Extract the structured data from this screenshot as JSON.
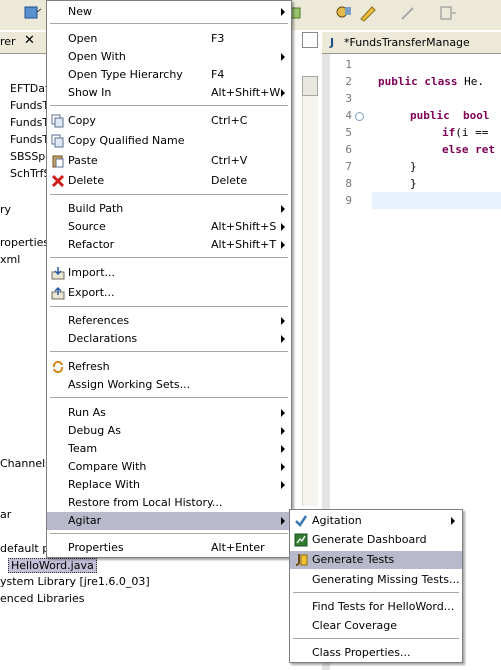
{
  "left_panel": {
    "tab_label": "rer",
    "tree_items": [
      "EFTDat",
      "FundsT",
      "FundsT",
      "FundsT",
      "SBSSpe",
      "SchTrfS",
      "ry",
      "roperties",
      "xml",
      "Channels",
      "ar",
      "default pa",
      "ystem Library [jre1.6.0_03]",
      "enced Libraries"
    ],
    "selected_file": "HelloWord.java"
  },
  "editor": {
    "tab_title": "*FundsTransferManage",
    "line_numbers": [
      "1",
      "2",
      "3",
      "4",
      "5",
      "6",
      "7",
      "8",
      "9"
    ],
    "line2_kw": "public class",
    "line2_rest": " He.",
    "line4_kw": "public  bool",
    "line5_kw": "if",
    "line5_rest": "(i ==",
    "line6_kw": "else ret",
    "line7": "}",
    "line8": "}"
  },
  "context_menu": {
    "items": [
      {
        "label": "New",
        "shortcut": "",
        "submenu": true
      },
      {
        "label": "Open",
        "shortcut": "F3",
        "submenu": false
      },
      {
        "label": "Open With",
        "shortcut": "",
        "submenu": true
      },
      {
        "label": "Open Type Hierarchy",
        "shortcut": "F4",
        "submenu": false
      },
      {
        "label": "Show In",
        "shortcut": "Alt+Shift+W",
        "submenu": true
      },
      {
        "label": "Copy",
        "shortcut": "Ctrl+C",
        "submenu": false,
        "icon": "copy-icon"
      },
      {
        "label": "Copy Qualified Name",
        "shortcut": "",
        "submenu": false,
        "icon": "copy-icon"
      },
      {
        "label": "Paste",
        "shortcut": "Ctrl+V",
        "submenu": false,
        "icon": "paste-icon"
      },
      {
        "label": "Delete",
        "shortcut": "Delete",
        "submenu": false,
        "icon": "delete-icon"
      },
      {
        "label": "Build Path",
        "shortcut": "",
        "submenu": true
      },
      {
        "label": "Source",
        "shortcut": "Alt+Shift+S",
        "submenu": true
      },
      {
        "label": "Refactor",
        "shortcut": "Alt+Shift+T",
        "submenu": true
      },
      {
        "label": "Import...",
        "shortcut": "",
        "submenu": false,
        "icon": "import-icon"
      },
      {
        "label": "Export...",
        "shortcut": "",
        "submenu": false,
        "icon": "export-icon"
      },
      {
        "label": "References",
        "shortcut": "",
        "submenu": true
      },
      {
        "label": "Declarations",
        "shortcut": "",
        "submenu": true
      },
      {
        "label": "Refresh",
        "shortcut": "",
        "submenu": false,
        "icon": "refresh-icon"
      },
      {
        "label": "Assign Working Sets...",
        "shortcut": "",
        "submenu": false
      },
      {
        "label": "Run As",
        "shortcut": "",
        "submenu": true
      },
      {
        "label": "Debug As",
        "shortcut": "",
        "submenu": true
      },
      {
        "label": "Team",
        "shortcut": "",
        "submenu": true
      },
      {
        "label": "Compare With",
        "shortcut": "",
        "submenu": true
      },
      {
        "label": "Replace With",
        "shortcut": "",
        "submenu": true
      },
      {
        "label": "Restore from Local History...",
        "shortcut": "",
        "submenu": false
      },
      {
        "label": "Agitar",
        "shortcut": "",
        "submenu": true,
        "highlighted": true
      },
      {
        "label": "Properties",
        "shortcut": "Alt+Enter",
        "submenu": false
      }
    ]
  },
  "agitar_submenu": {
    "items": [
      {
        "label": "Agitation",
        "submenu": true,
        "icon": "check-icon"
      },
      {
        "label": "Generate Dashboard",
        "icon": "dashboard-icon"
      },
      {
        "label": "Generate Tests",
        "icon": "tests-icon",
        "highlighted": true
      },
      {
        "label": "Generating Missing Tests..."
      },
      {
        "label": "Find Tests for HelloWord..."
      },
      {
        "label": "Clear Coverage"
      },
      {
        "label": "Class Properties..."
      }
    ]
  },
  "colors": {
    "highlight": "#b9b9cc",
    "keyword": "#7f0055",
    "toolbar": "#ece9d8"
  }
}
